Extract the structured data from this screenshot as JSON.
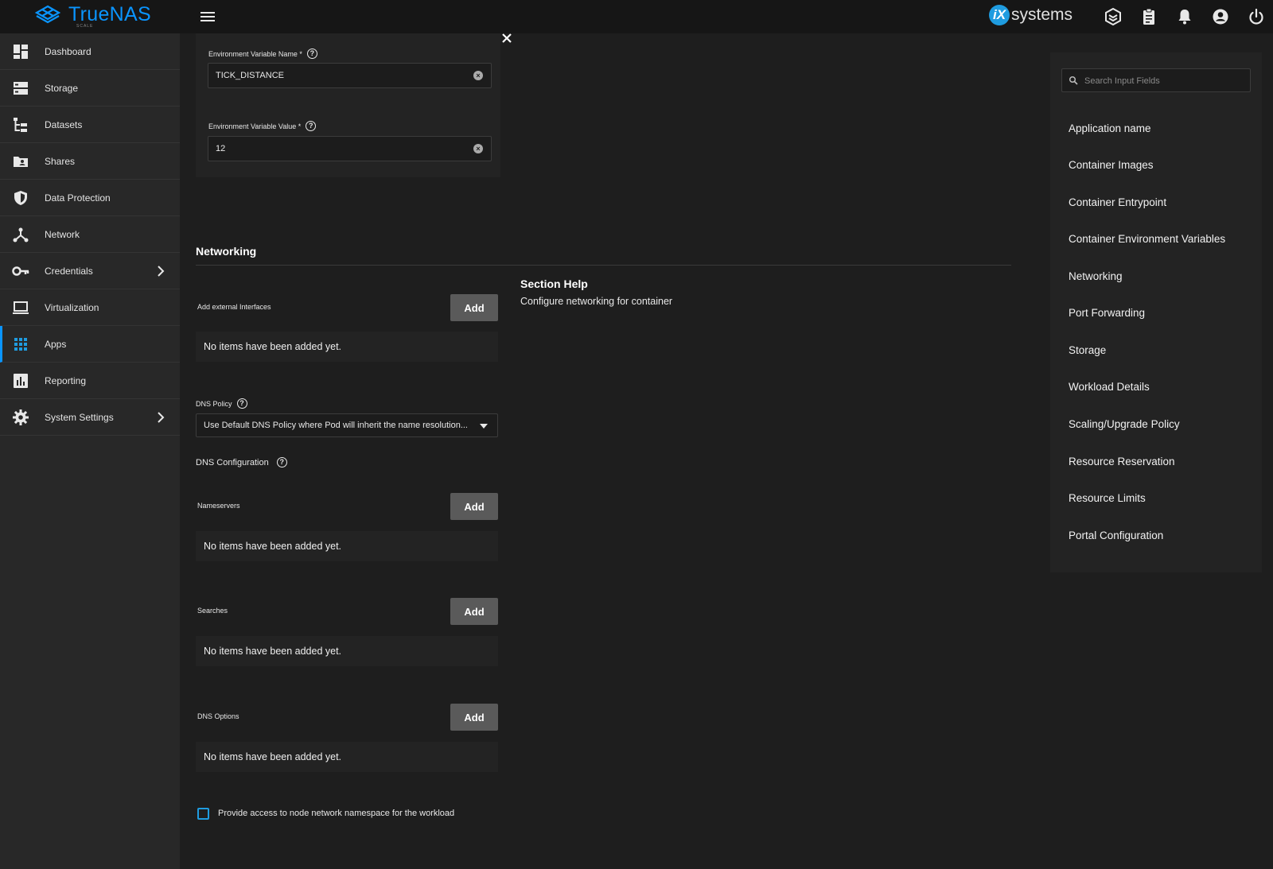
{
  "header": {
    "logo_text": "TrueNAS",
    "logo_sub": "SCALE",
    "brand_ix": "iX",
    "brand_text": "systems"
  },
  "sidebar": {
    "items": [
      {
        "label": "Dashboard",
        "icon": "dashboard-icon"
      },
      {
        "label": "Storage",
        "icon": "storage-icon"
      },
      {
        "label": "Datasets",
        "icon": "datasets-icon"
      },
      {
        "label": "Shares",
        "icon": "shares-icon"
      },
      {
        "label": "Data Protection",
        "icon": "shield-icon"
      },
      {
        "label": "Network",
        "icon": "network-icon"
      },
      {
        "label": "Credentials",
        "icon": "key-icon"
      },
      {
        "label": "Virtualization",
        "icon": "laptop-icon"
      },
      {
        "label": "Apps",
        "icon": "apps-grid-icon"
      },
      {
        "label": "Reporting",
        "icon": "bar-chart-icon"
      },
      {
        "label": "System Settings",
        "icon": "gear-icon"
      }
    ],
    "active": "Apps"
  },
  "env": {
    "name_label": "Environment Variable Name *",
    "name_value": "TICK_DISTANCE",
    "value_label": "Environment Variable Value *",
    "value_value": "12"
  },
  "networking": {
    "title": "Networking",
    "help_title": "Section Help",
    "help_text": "Configure networking for container",
    "add_label": "Add",
    "empty_text": "No items have been added yet.",
    "external_interfaces_label": "Add external Interfaces",
    "dns_policy_label": "DNS Policy",
    "dns_policy_value": "Use Default DNS Policy where Pod will inherit the name resolution...",
    "dns_config_label": "DNS Configuration",
    "nameservers_label": "Nameservers",
    "searches_label": "Searches",
    "dns_options_label": "DNS Options",
    "host_network_label": "Provide access to node network namespace for the workload"
  },
  "toc": {
    "search_placeholder": "Search Input Fields",
    "items": [
      "Application name",
      "Container Images",
      "Container Entrypoint",
      "Container Environment Variables",
      "Networking",
      "Port Forwarding",
      "Storage",
      "Workload Details",
      "Scaling/Upgrade Policy",
      "Resource Reservation",
      "Resource Limits",
      "Portal Configuration"
    ]
  },
  "colors": {
    "accent": "#0a95ff",
    "topbar": "#161616",
    "sidebar": "#282828",
    "background": "#1e1e1e",
    "button": "#5a5a5a"
  }
}
